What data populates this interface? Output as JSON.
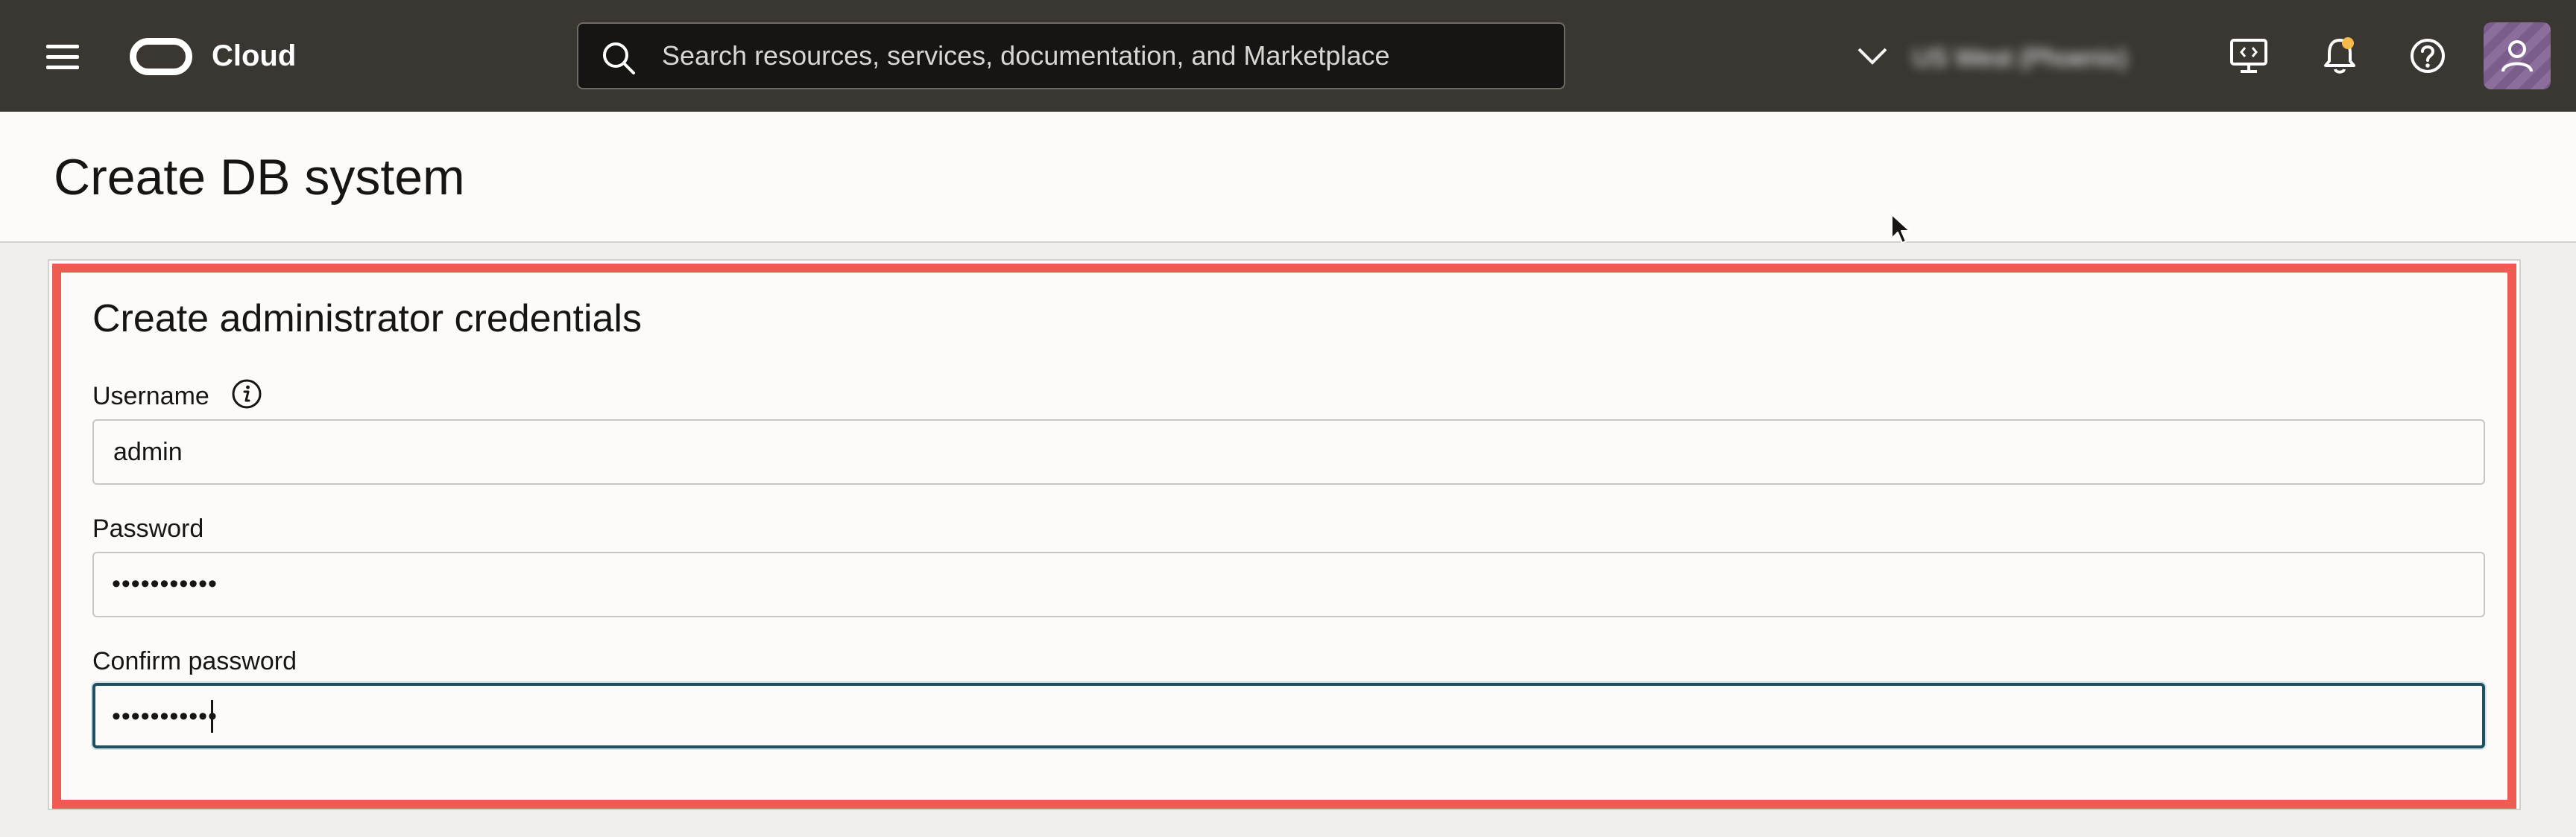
{
  "header": {
    "brand": "Cloud",
    "search_placeholder": "Search resources, services, documentation, and Marketplace",
    "region_name": "US West (Phoenix)",
    "icons": [
      "menu-icon",
      "oracle-logo-icon",
      "search-icon",
      "chevron-down-icon",
      "cloud-shell-icon",
      "bell-icon",
      "help-icon",
      "user-icon"
    ]
  },
  "page": {
    "title": "Create DB system"
  },
  "section": {
    "title": "Create administrator credentials",
    "fields": {
      "username": {
        "label": "Username",
        "value": "admin"
      },
      "password": {
        "label": "Password",
        "value": "•••••••••••"
      },
      "confirm_password": {
        "label": "Confirm password",
        "value": "•••••••••••"
      }
    }
  },
  "colors": {
    "header_bg": "#3a3632",
    "highlight": "#ef5b52",
    "focus_border": "#1f4f60",
    "notification_dot": "#f6b94b"
  }
}
